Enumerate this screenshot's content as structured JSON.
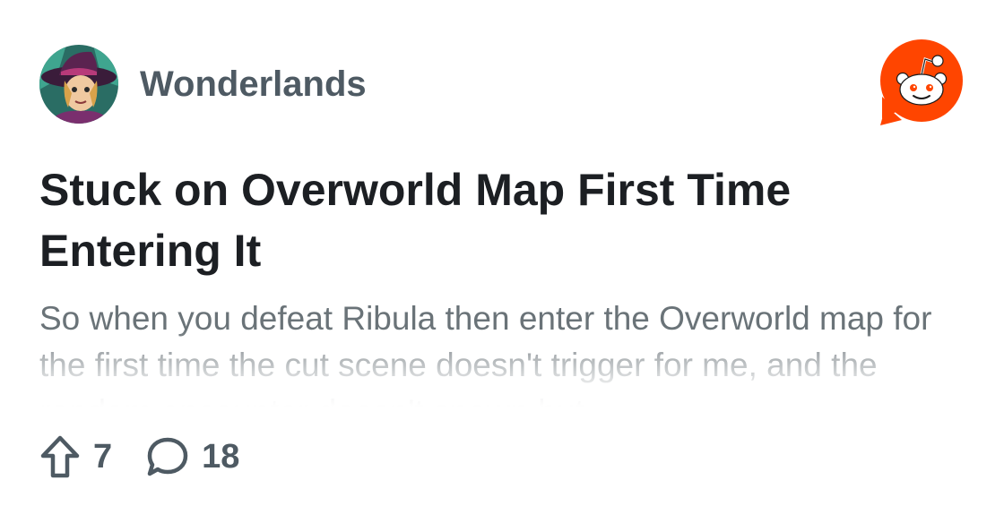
{
  "post": {
    "subreddit": "Wonderlands",
    "title": "Stuck on Overworld Map First Time Entering It",
    "body": "So when you defeat Ribula then enter the Overworld map for the first time the cut scene doesn't trigger for me, and the random encounter doesn't spawn but"
  },
  "footer": {
    "upvotes": "7",
    "comments": "18"
  },
  "icons": {
    "avatar": "subreddit-avatar",
    "logo": "reddit-logo-icon",
    "upvote": "upvote-arrow-icon",
    "comment": "comment-bubble-icon"
  },
  "colors": {
    "reddit_orange": "#ff4500",
    "title": "#1c1f23",
    "body": "#6a7378",
    "meta": "#4e5a63"
  }
}
